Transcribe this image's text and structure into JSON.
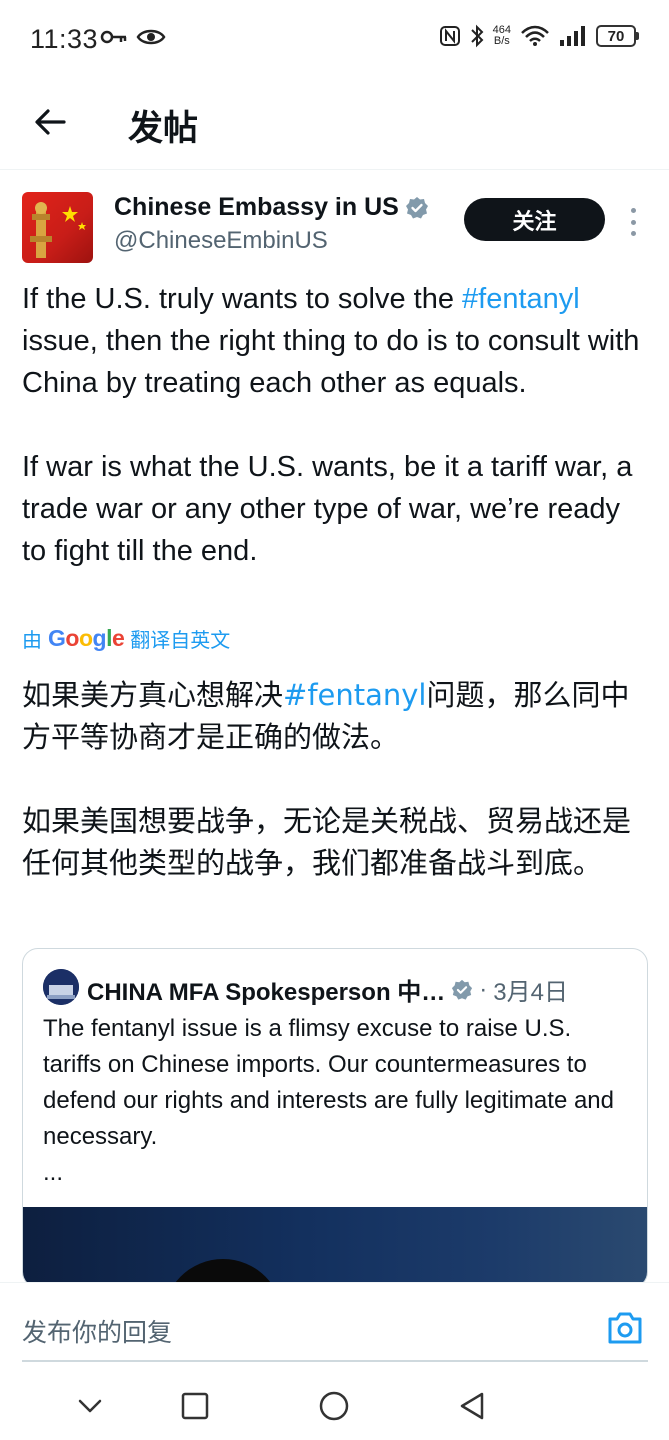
{
  "status_bar": {
    "time": "11:33",
    "net_speed_value": "464",
    "net_speed_unit": "B/s",
    "battery_level": "70",
    "icons": [
      "key-icon",
      "eye-icon",
      "nfc-icon",
      "bluetooth-icon",
      "wifi-icon",
      "signal-icon",
      "battery-icon"
    ]
  },
  "header": {
    "title": "发帖",
    "back_icon": "arrow-left-icon"
  },
  "post": {
    "author_name": "Chinese Embassy in US",
    "author_handle": "@ChineseEmbinUS",
    "verified": true,
    "follow_label": "关注",
    "text_paragraphs": [
      {
        "before": "If the U.S. truly wants to solve the ",
        "hashtag": "#fentanyl",
        "after": " issue, then the right thing to do is to consult with China by treating each other as equals."
      },
      {
        "before": "If war is what the U.S. wants, be it a tariff war, a trade war or any other type of war, we’re ready to fight till the end.",
        "hashtag": "",
        "after": ""
      }
    ],
    "translate_prefix": "由",
    "translate_brand": "Google",
    "translate_suffix": "翻译自英文",
    "translated_paragraphs": [
      {
        "before": "如果美方真心想解决",
        "hashtag": "#fentanyl",
        "after": "问题，那么同中方平等协商才是正确的做法。"
      },
      {
        "before": "如果美国想要战争，无论是关税战、贸易战还是任何其他类型的战争，我们都准备战斗到底。",
        "hashtag": "",
        "after": ""
      }
    ]
  },
  "quote": {
    "author_name": "CHINA MFA Spokesperson 中…",
    "verified": true,
    "separator": "·",
    "date": "3月4日",
    "text": "The fentanyl issue is a flimsy excuse to raise U.S. tariffs on Chinese imports. Our countermeasures to defend our rights and interests are fully legitimate and necessary.",
    "ellipsis": "..."
  },
  "reply": {
    "placeholder": "发布你的回复",
    "camera_icon": "camera-icon"
  },
  "colors": {
    "link": "#1d9bf0",
    "text": "#0f1419",
    "secondary": "#536471",
    "follow_bg": "#0f1419"
  }
}
